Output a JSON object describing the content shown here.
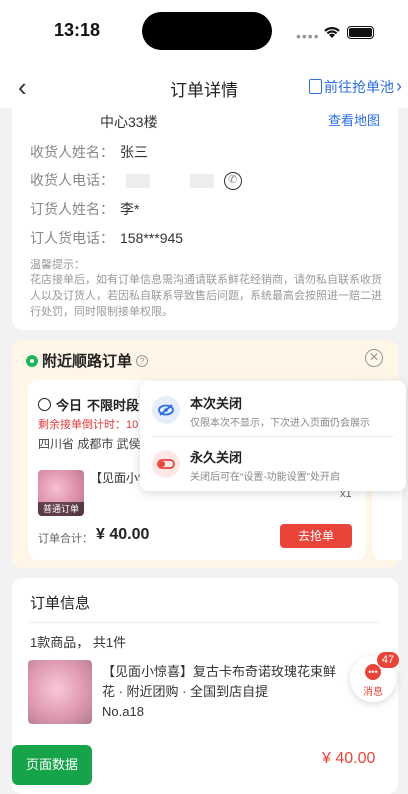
{
  "status_bar": {
    "time": "13:18"
  },
  "nav": {
    "back_icon": "‹",
    "title": "订单详情",
    "right_link": "前往抢单池",
    "right_chevron": "›"
  },
  "receiver": {
    "address_tail": "中心33楼",
    "map_link": "查看地图",
    "name_label": "收货人姓名：",
    "name": "张三",
    "phone_label": "收货人电话：",
    "orderer_label": "订货人姓名：",
    "orderer": "李*",
    "orderer_phone_label": "订人货电话：",
    "orderer_phone": "158***945",
    "tip_title": "温馨提示：",
    "tip_body": "花店接单后，如有订单信息需沟通请联系鲜花经销商，请勿私自联系收货人以及订货人，若因私自联系导致售后问题，系统最高会按照进一赔二进行处罚，同时限制接单权限。"
  },
  "nearby": {
    "title": "附近顺路订单",
    "help": "?",
    "close": "✕",
    "today_label": "今日",
    "time_label": "不限时段",
    "countdown": "剩余接单倒计时：10",
    "region": "四川省 成都市 武侯",
    "product_tag": "普通订单",
    "product_name": "【见面小惊喜】近团购 · 全国到店自提 No.a18",
    "qty": "x1",
    "total_label": "订单合计：",
    "total": "¥ 40.00",
    "grab": "去抢单"
  },
  "close_popup": {
    "once_title": "本次关闭",
    "once_sub": "仅限本次不显示，下次进入页面仍会展示",
    "forever_title": "永久关闭",
    "forever_sub": "关闭后可在“设置-功能设置”处开启"
  },
  "order_info": {
    "title": "订单信息",
    "count": "1款商品，  共1件",
    "product_name": "【见面小惊喜】复古卡布奇诺玫瑰花束鲜花 · 附近团购 · 全国到店自提",
    "product_code": "No.a18",
    "price": "¥ 40.00"
  },
  "message": {
    "label": "消息",
    "badge": "47"
  },
  "page_data_button": "页面数据",
  "colors": {
    "accent": "#2d6ee0",
    "danger": "#e8443a",
    "green": "#16a34a"
  }
}
